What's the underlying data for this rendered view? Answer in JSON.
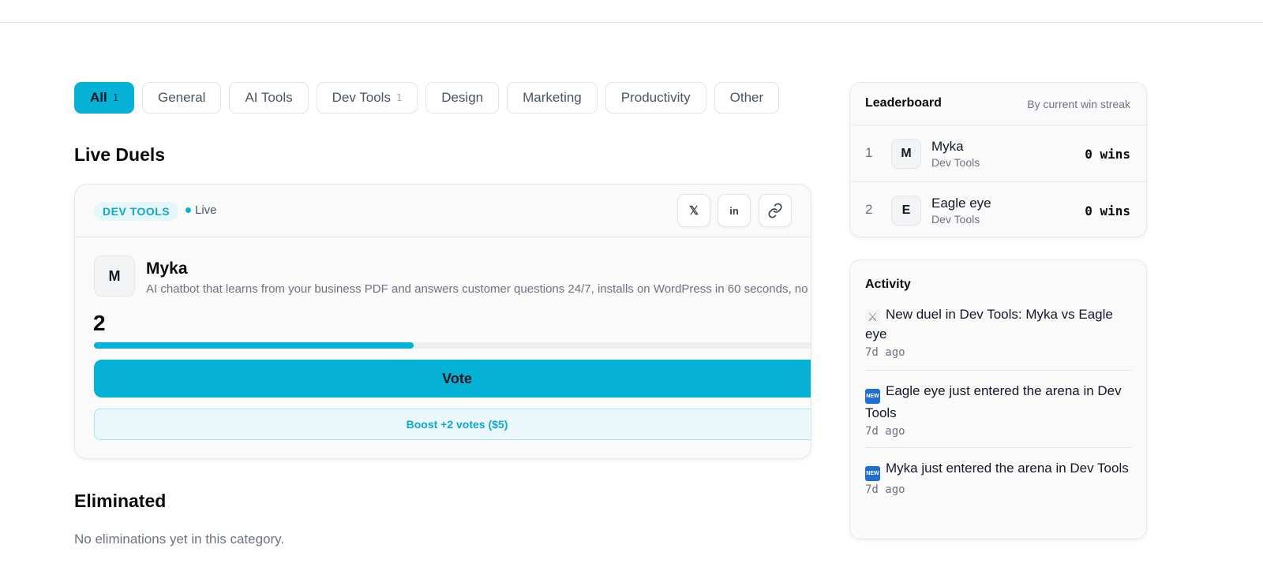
{
  "categories": [
    {
      "label": "All",
      "count": "1",
      "active": true
    },
    {
      "label": "General",
      "count": ""
    },
    {
      "label": "AI Tools",
      "count": ""
    },
    {
      "label": "Dev Tools",
      "count": "1"
    },
    {
      "label": "Design",
      "count": ""
    },
    {
      "label": "Marketing",
      "count": ""
    },
    {
      "label": "Productivity",
      "count": ""
    },
    {
      "label": "Other",
      "count": ""
    }
  ],
  "live_duels": {
    "heading": "Live Duels",
    "card": {
      "category_tag": "DEV TOOLS",
      "status": "Live",
      "share": {
        "x": "X",
        "linkedin": "in",
        "link": "link-icon"
      },
      "entry": {
        "avatar_letter": "M",
        "name": "Myka",
        "description": "AI chatbot that learns from your business PDF and answers customer questions 24/7, installs on WordPress in 60 seconds, no",
        "votes": "2",
        "progress": 0.44
      },
      "vote_label": "Vote",
      "boost_label": "Boost +2 votes ($5)"
    }
  },
  "eliminated": {
    "heading": "Eliminated",
    "empty_text": "No eliminations yet in this category."
  },
  "leaderboard": {
    "title": "Leaderboard",
    "subtitle": "By current win streak",
    "rows": [
      {
        "rank": "1",
        "avatar": "M",
        "name": "Myka",
        "category": "Dev Tools",
        "wins": "0 wins"
      },
      {
        "rank": "2",
        "avatar": "E",
        "name": "Eagle eye",
        "category": "Dev Tools",
        "wins": "0 wins"
      }
    ]
  },
  "activity": {
    "title": "Activity",
    "items": [
      {
        "icon": "crossed-swords-icon",
        "text": "New duel in Dev Tools: Myka vs Eagle eye",
        "time": "7d ago"
      },
      {
        "icon": "new-badge-icon",
        "badge": "NEW",
        "text": "Eagle eye just entered the arena in Dev Tools",
        "time": "7d ago"
      },
      {
        "icon": "new-badge-icon",
        "badge": "NEW",
        "text": "Myka just entered the arena in Dev Tools",
        "time": "7d ago"
      }
    ]
  },
  "colors": {
    "accent": "#05b1d4",
    "accent_light": "#eaf8fb",
    "text_muted": "#6b7280",
    "border": "#e5e7eb"
  }
}
